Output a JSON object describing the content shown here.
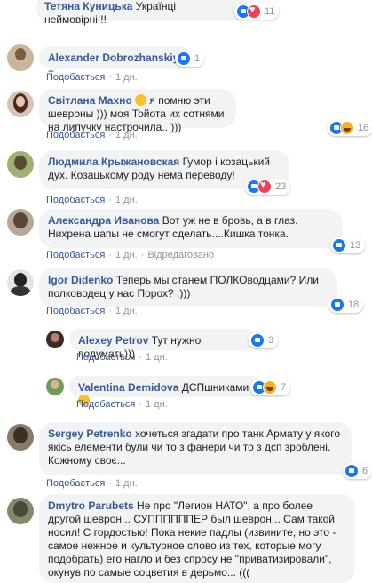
{
  "comments": [
    {
      "author": "Тетяна Куницька",
      "text": "Українці неймовірні!!!",
      "reactions": [
        "like",
        "love"
      ],
      "count": "11",
      "actions": null
    },
    {
      "author": "Alexander Dobrozhanskiy",
      "text": "+",
      "reactions": [
        "like"
      ],
      "count": "1",
      "actions": {
        "like": "Подобається",
        "time": "1 дн."
      }
    },
    {
      "author": "Світлана Махно",
      "text": "я помню эти шевроны ))) моя Тойота их сотнями на липучку настрочила.. )))",
      "reactions": [
        "like",
        "haha"
      ],
      "count": "16",
      "actions": {
        "like": "Подобається",
        "time": "1 дн."
      }
    },
    {
      "author": "Людмила Крыжановская",
      "text": "Гумор і козацький дух. Козацькому роду нема переводу!",
      "reactions": [
        "like",
        "love"
      ],
      "count": "23",
      "actions": {
        "like": "Подобається",
        "time": "1 дн."
      }
    },
    {
      "author": "Александра Иванова",
      "text": "Вот уж не в бровь, а в глаз. Нихрена цапы не смогут сделать....Кишка тонка.",
      "reactions": [
        "like"
      ],
      "count": "13",
      "actions": {
        "like": "Подобається",
        "time": "1 дн.",
        "edited": "Відредаговано"
      }
    },
    {
      "author": "Igor Didenko",
      "text": "Теперь мы станем ПОЛКОводцами? Или полководец у нас Порох? :)))",
      "reactions": [
        "like"
      ],
      "count": "18",
      "actions": {
        "like": "Подобається",
        "time": "1 дн."
      }
    },
    {
      "author": "Alexey Petrov",
      "text": "Тут нужно подумать)))",
      "reactions": [
        "like"
      ],
      "count": "3",
      "actions": {
        "like": "Подобається",
        "time": "1 дн."
      }
    },
    {
      "author": "Valentina Demidova",
      "text": "ДСПшниками",
      "reactions": [
        "like",
        "haha"
      ],
      "count": "7",
      "actions": {
        "like": "Подобається",
        "time": "1 дн."
      }
    },
    {
      "author": "Sergey Petrenko",
      "text": "хочеться згадати про танк Армату у якого якісь елементи були чи то з фанери чи то з дсп зроблені. Кожному своє...",
      "reactions": [
        "like"
      ],
      "count": "6",
      "actions": {
        "like": "Подобається",
        "time": "1 дн."
      }
    },
    {
      "author": "Dmytro Parubets",
      "text": "Не про \"Легион НАТО\", а про более другой шеврон... СУППППППЕР был шеврон... Сам такой носил! С гордостью! Пока некие падлы (извините, но это - самое нежное и культурное слово из тех, которые могу подобрать) его нагло и без спросу не \"приватизировали\", окунув по самые соцветия в дерьмо... (((",
      "reactions": [],
      "count": "",
      "actions": null
    }
  ],
  "colors": {
    "link": "#385898",
    "bubble": "#f2f3f5",
    "meta": "#90949c"
  }
}
